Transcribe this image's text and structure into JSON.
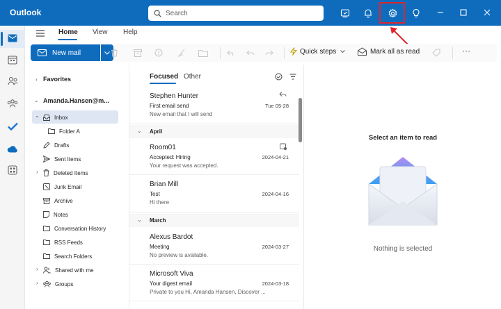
{
  "app": {
    "title": "Outlook"
  },
  "search": {
    "placeholder": "Search"
  },
  "ribbon_tabs": [
    {
      "label": "Home"
    },
    {
      "label": "View"
    },
    {
      "label": "Help"
    }
  ],
  "toolbar": {
    "new_mail_label": "New mail",
    "quick_steps_label": "Quick steps",
    "mark_all_read_label": "Mark all as read",
    "more_label": "···"
  },
  "folders": {
    "favorites_label": "Favorites",
    "account_label": "Amanda.Hansen@m...",
    "items": [
      {
        "label": "Inbox"
      },
      {
        "label": "Folder A"
      },
      {
        "label": "Drafts"
      },
      {
        "label": "Sent Items"
      },
      {
        "label": "Deleted Items"
      },
      {
        "label": "Junk Email"
      },
      {
        "label": "Archive"
      },
      {
        "label": "Notes"
      },
      {
        "label": "Conversation History"
      },
      {
        "label": "RSS Feeds"
      },
      {
        "label": "Search Folders"
      },
      {
        "label": "Shared with me"
      },
      {
        "label": "Groups"
      }
    ]
  },
  "message_list": {
    "tabs": [
      {
        "label": "Focused"
      },
      {
        "label": "Other"
      }
    ],
    "groups": [
      {
        "label": "April"
      },
      {
        "label": "March"
      }
    ],
    "messages": [
      {
        "sender": "Stephen Hunter",
        "subject": "First email send",
        "preview": "New email that I will send",
        "date": "Tue 05-28"
      },
      {
        "sender": "Room01",
        "subject": "Accepted: Hiring",
        "preview": "Your request was accepted.",
        "date": "2024-04-21"
      },
      {
        "sender": "Brian Mill",
        "subject": "Test",
        "preview": "Hi there",
        "date": "2024-04-16"
      },
      {
        "sender": "Alexus Bardot",
        "subject": "Meeting",
        "preview": "No preview is available.",
        "date": "2024-03-27"
      },
      {
        "sender": "Microsoft Viva",
        "subject": "Your digest email",
        "preview": "Private to you Hi, Amanda Hansen, Discover ...",
        "date": "2024-03-18"
      }
    ]
  },
  "reading_pane": {
    "title": "Select an item to read",
    "empty_text": "Nothing is selected"
  },
  "colors": {
    "brand": "#0f6cbd",
    "highlight": "#e0242c"
  }
}
